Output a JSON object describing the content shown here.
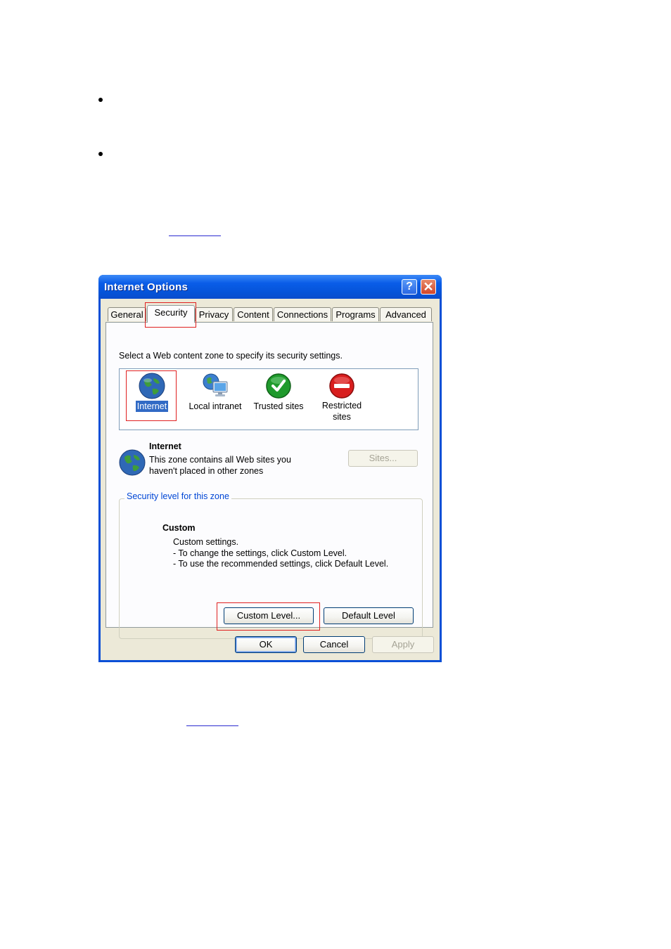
{
  "document": {
    "bullets": 2,
    "links": 2
  },
  "dialog": {
    "title": "Internet Options",
    "help_glyph": "?",
    "close_glyph": "✕",
    "tabs": [
      {
        "label": "General"
      },
      {
        "label": "Security"
      },
      {
        "label": "Privacy"
      },
      {
        "label": "Content"
      },
      {
        "label": "Connections"
      },
      {
        "label": "Programs"
      },
      {
        "label": "Advanced"
      }
    ],
    "active_tab": "Security",
    "zone_prompt": "Select a Web content zone to specify its security settings.",
    "zones": [
      {
        "label": "Internet",
        "icon": "globe-icon",
        "selected": true
      },
      {
        "label": "Local intranet",
        "icon": "intranet-icon",
        "selected": false
      },
      {
        "label": "Trusted sites",
        "icon": "checkmark-icon",
        "selected": false
      },
      {
        "label_line1": "Restricted",
        "label_line2": "sites",
        "icon": "no-entry-icon",
        "selected": false
      }
    ],
    "zone_info": {
      "name": "Internet",
      "description_line1": "This zone contains all Web sites you",
      "description_line2": "haven't placed in other zones",
      "sites_button": "Sites..."
    },
    "security_level": {
      "legend": "Security level for this zone",
      "level_name": "Custom",
      "line1": "Custom settings.",
      "line2": "- To change the settings, click Custom Level.",
      "line3": "- To use the recommended settings, click Default Level.",
      "custom_button": "Custom Level...",
      "default_button": "Default Level"
    },
    "footer": {
      "ok": "OK",
      "cancel": "Cancel",
      "apply": "Apply"
    },
    "colors": {
      "title_bar": "#0553d8",
      "face": "#ece9d8",
      "highlight_box": "#e02020",
      "selection": "#316ac5"
    }
  }
}
